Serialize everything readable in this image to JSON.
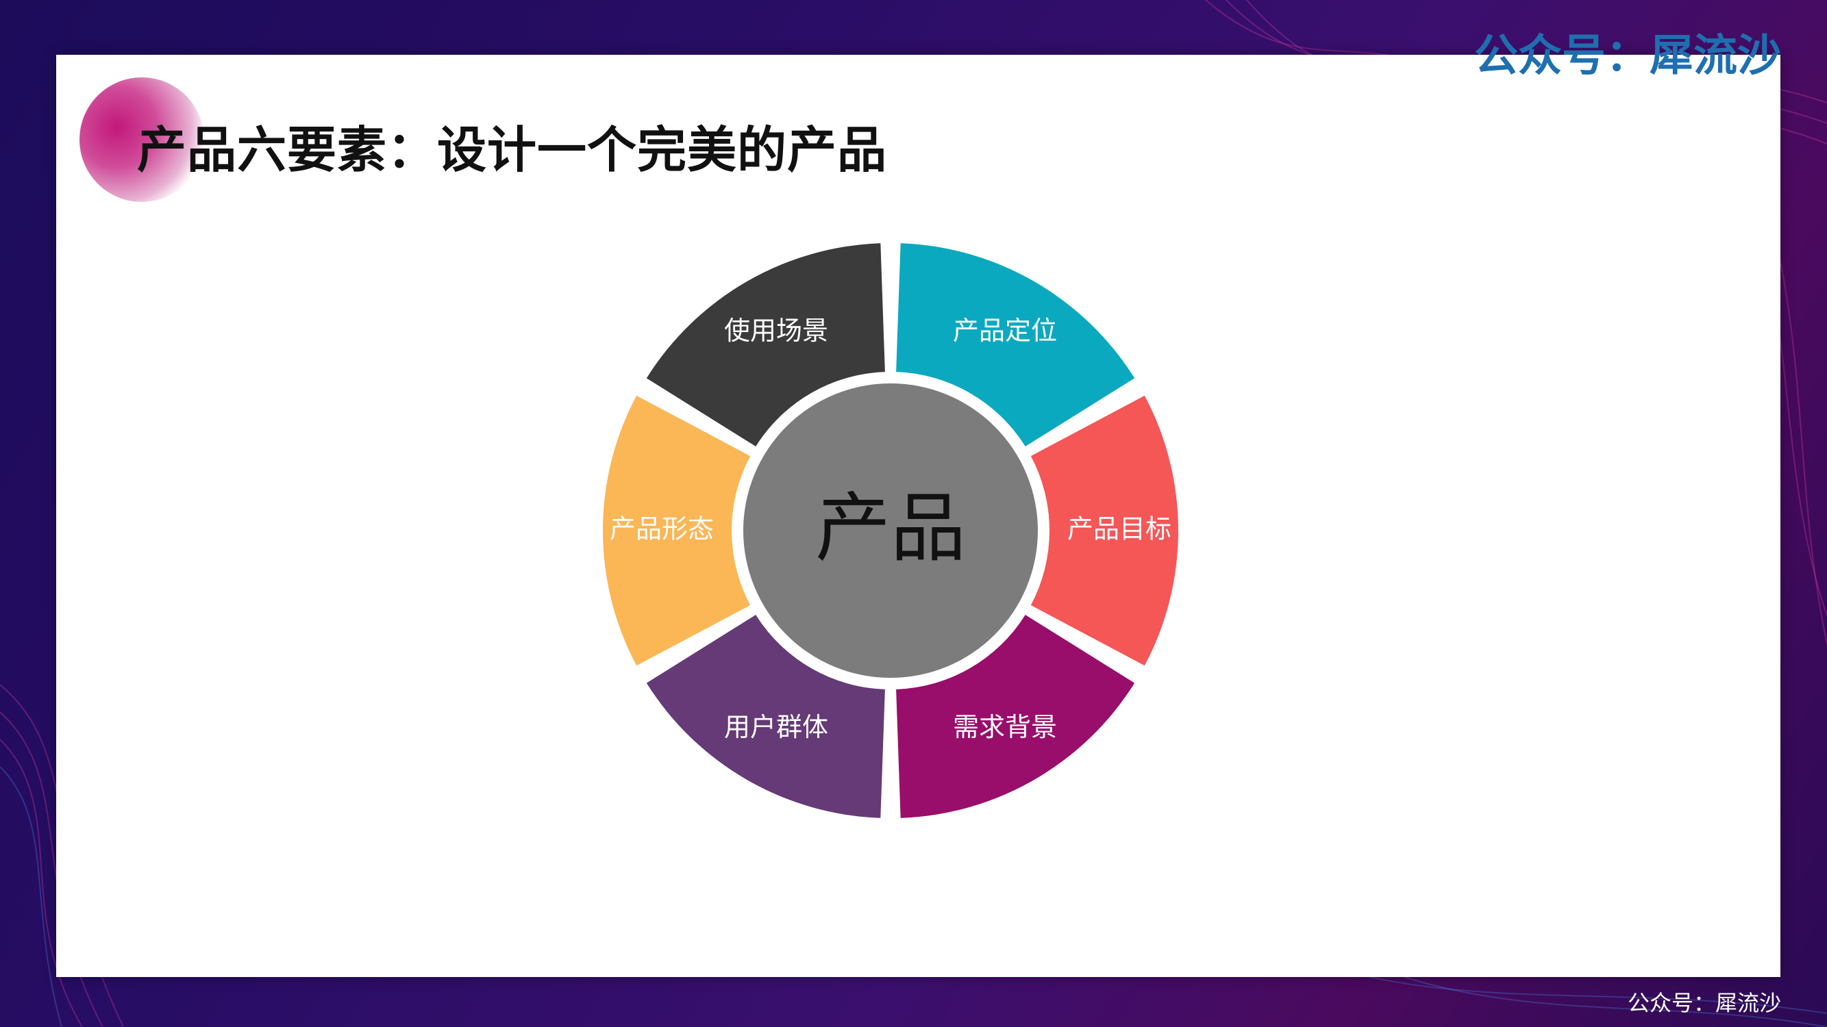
{
  "slide": {
    "title": "产品六要素：设计一个完美的产品"
  },
  "watermark": {
    "top": "公众号：犀流沙",
    "bottom": "公众号：犀流沙"
  },
  "diagram": {
    "center_label": "产品",
    "segments": [
      {
        "label": "产品定位",
        "color": "#0aa9bf"
      },
      {
        "label": "产品目标",
        "color": "#f55656"
      },
      {
        "label": "需求背景",
        "color": "#990d6b"
      },
      {
        "label": "用户群体",
        "color": "#653a76"
      },
      {
        "label": "产品形态",
        "color": "#fbb655"
      },
      {
        "label": "使用场景",
        "color": "#3b3b3b"
      }
    ],
    "center_color": "#7c7c7c"
  },
  "colors": {
    "background": "#2a0d66",
    "accent_pink": "#c2187a",
    "watermark_blue": "#1e6fb0"
  }
}
